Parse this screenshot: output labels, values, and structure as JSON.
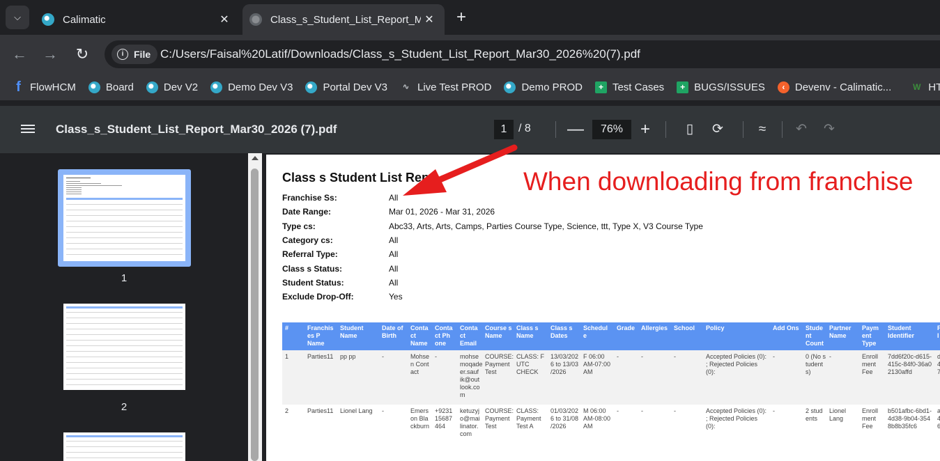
{
  "browser": {
    "tabs": [
      {
        "title": "Calimatic",
        "close": "✕"
      },
      {
        "title": "Class_s_Student_List_Report_Ma",
        "close": "✕"
      }
    ],
    "new_tab": "+",
    "address": {
      "chip": "File",
      "url": "C:/Users/Faisal%20Latif/Downloads/Class_s_Student_List_Report_Mar30_2026%20(7).pdf"
    },
    "bookmarks": [
      {
        "label": "FlowHCM",
        "icon": "flowhcm-f-icon"
      },
      {
        "label": "Board",
        "icon": "globe-icon"
      },
      {
        "label": "Dev V2",
        "icon": "globe-icon"
      },
      {
        "label": "Demo Dev V3",
        "icon": "globe-icon"
      },
      {
        "label": "Portal Dev V3",
        "icon": "globe-icon"
      },
      {
        "label": "Live Test PROD",
        "icon": "wave-icon"
      },
      {
        "label": "Demo PROD",
        "icon": "globe-icon"
      },
      {
        "label": "Test Cases",
        "icon": "sheets-icon"
      },
      {
        "label": "BUGS/ISSUES",
        "icon": "sheets-icon"
      },
      {
        "label": "Devenv - Calimatic...",
        "icon": "devenv-icon"
      },
      {
        "label": "HT",
        "icon": "w-icon"
      }
    ]
  },
  "pdf": {
    "title": "Class_s_Student_List_Report_Mar30_2026 (7).pdf",
    "page_current": "1",
    "page_total": "/  8",
    "zoom": "76%",
    "thumbnails": [
      "1",
      "2"
    ]
  },
  "report": {
    "title": "Class s Student List Rep",
    "filters": [
      {
        "label": "Franchise Ss:",
        "value": "All"
      },
      {
        "label": "Date Range:",
        "value": "Mar 01, 2026 - Mar 31, 2026"
      },
      {
        "label": "Type cs:",
        "value": "Abc33, Arts, Arts, Camps, Parties Course Type, Science, ttt, Type X, V3 Course Type"
      },
      {
        "label": "Category cs:",
        "value": "All"
      },
      {
        "label": "Referral Type:",
        "value": "All"
      },
      {
        "label": "Class s Status:",
        "value": "All"
      },
      {
        "label": "Student Status:",
        "value": "All"
      },
      {
        "label": "Exclude Drop-Off:",
        "value": "Yes"
      }
    ],
    "columns": [
      "#",
      "Franchis\nes P\nName",
      "Student\nName",
      "Date of\nBirth",
      "Conta\nct\nName",
      "Conta\nct Ph\none",
      "Conta\nct\nEmail",
      "Course s\nName",
      "Class s\nName",
      "Class s\nDates",
      "Schedul\ne",
      "Grade",
      "Allergies",
      "School",
      "Policy",
      "Add Ons",
      "Stude\nnt\nCount",
      "Partner\nName",
      "Paym\nent\nType",
      "Student\nIdentifier",
      "F\nI"
    ],
    "rows": [
      [
        "1",
        "Parties11",
        "pp pp",
        "-",
        "Mohse\nn Cont\nact",
        "-",
        "mohse\nmoqade\ner.sauf\nik@out\nlook.co\nm",
        "COURSE:\nPayment\nTest",
        "CLASS: F\nUTC\nCHECK",
        "13/03/202\n6 to 13/03\n/2026",
        "F 06:00\nAM-07:00\nAM",
        "-",
        "-",
        "-",
        "Accepted Policies (0):\n; Rejected Policies\n(0):",
        "-",
        "0 (No s\ntudent\ns)",
        "-",
        "Enroll\nment\nFee",
        "7dd6f20c-d615-\n415c-84f0-36a0\n2130affd",
        "d\n4\n7"
      ],
      [
        "2",
        "Parties11",
        "Lionel Lang",
        "-",
        "Emers\non Bla\nckburn",
        "+9231\n15687\n464",
        "ketuzyj\no@mai\nlinator.\ncom",
        "COURSE:\nPayment\nTest",
        "CLASS:\nPayment\nTest A",
        "01/03/202\n6 to 31/08\n/2026",
        "M 06:00\nAM-08:00\nAM",
        "-",
        "-",
        "-",
        "Accepted Policies (0):\n; Rejected Policies\n(0):",
        "-",
        "2 stud\nents",
        "Lionel\nLang",
        "Enroll\nment\nFee",
        "b501afbc-6bd1-\n4d38-9b04-354\n8b8b35fc6",
        "a\n4\n6"
      ]
    ]
  },
  "annotation": {
    "text": "When downloading from franchise",
    "color": "#e61e1e"
  },
  "colors": {
    "table_header": "#5b93f2",
    "thumb_selected": "#8ab4f8"
  }
}
